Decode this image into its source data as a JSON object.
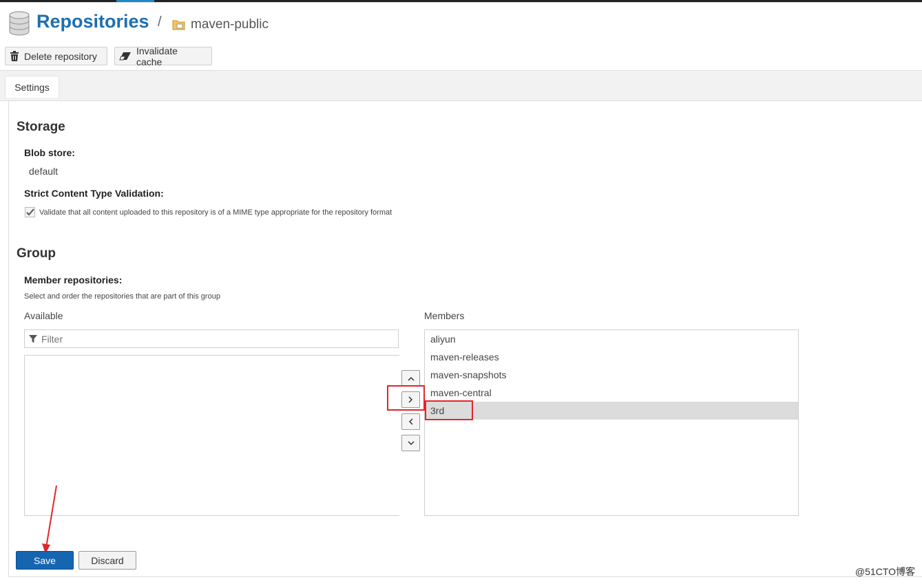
{
  "header": {
    "title": "Repositories",
    "separator": "/",
    "repo_name": "maven-public"
  },
  "toolbar": {
    "delete_label": "Delete repository",
    "invalidate_label": "Invalidate cache"
  },
  "tabs": [
    {
      "label": "Settings"
    }
  ],
  "storage": {
    "section_title": "Storage",
    "blob_store_label": "Blob store:",
    "blob_store_value": "default",
    "strict_label": "Strict Content Type Validation:",
    "strict_checked": true,
    "strict_description": "Validate that all content uploaded to this repository is of a MIME type appropriate for the repository format"
  },
  "group": {
    "section_title": "Group",
    "members_label": "Member repositories:",
    "members_help": "Select and order the repositories that are part of this group",
    "available_label": "Available",
    "members_column_label": "Members",
    "filter_placeholder": "Filter",
    "available_items": [],
    "members": [
      {
        "name": "aliyun",
        "selected": false
      },
      {
        "name": "maven-releases",
        "selected": false
      },
      {
        "name": "maven-snapshots",
        "selected": false
      },
      {
        "name": "maven-central",
        "selected": false
      },
      {
        "name": "3rd",
        "selected": true
      }
    ]
  },
  "actions": {
    "save_label": "Save",
    "discard_label": "Discard"
  },
  "icons": {
    "repositories": "database-icon",
    "repo": "folder-icon",
    "delete": "trash-icon",
    "invalidate": "eraser-icon",
    "filter": "funnel-icon",
    "move_up": "chevron-up-icon",
    "add": "chevron-right-icon",
    "remove": "chevron-left-icon",
    "move_down": "chevron-down-icon"
  },
  "annotation_color": "#e0262a",
  "watermark": "@51CTO博客"
}
